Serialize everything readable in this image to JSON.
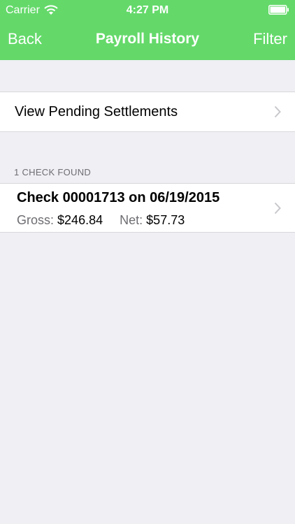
{
  "status_bar": {
    "carrier": "Carrier",
    "time": "4:27 PM",
    "wifi_icon": "wifi-icon",
    "battery_icon": "battery-icon"
  },
  "nav": {
    "back_label": "Back",
    "title": "Payroll History",
    "filter_label": "Filter"
  },
  "pending": {
    "label": "View Pending Settlements",
    "chevron_icon": "chevron-right-icon"
  },
  "results": {
    "header": "1 CHECK FOUND",
    "checks": [
      {
        "title": "Check 00001713 on 06/19/2015",
        "gross_label": "Gross:",
        "gross_value": "$246.84",
        "net_label": "Net:",
        "net_value": "$57.73"
      }
    ]
  },
  "colors": {
    "header_bg": "#64d96a",
    "page_bg": "#efeff4",
    "secondary_text": "#6d6d72"
  }
}
